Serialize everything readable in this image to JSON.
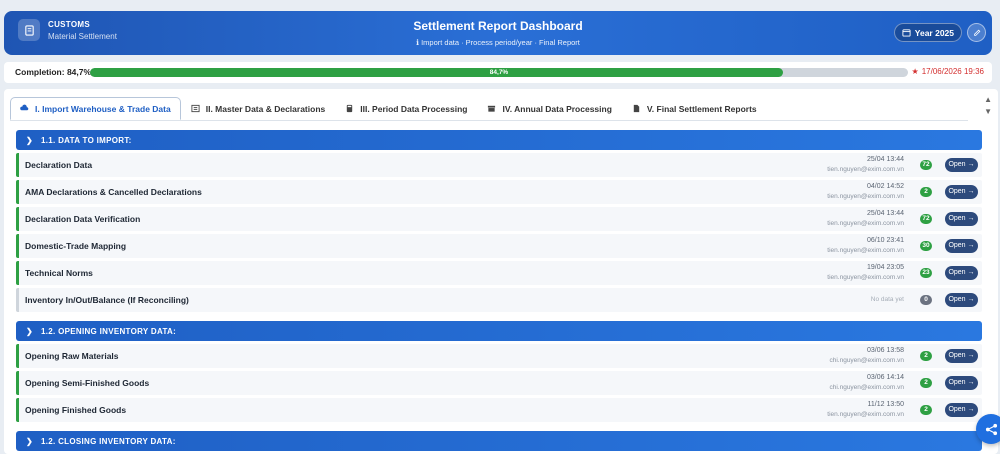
{
  "header": {
    "brand_line1": "CUSTOMS",
    "brand_line2": "Material Settlement",
    "title": "Settlement Report Dashboard",
    "subtitle": "Import data · Process period/year · Final Report",
    "year_label": "Year 2025"
  },
  "progress": {
    "label": "Completion: 84,7%",
    "percent": 84.7,
    "percent_text": "84,7%",
    "deadline": "17/06/2026 19:36"
  },
  "tabs": [
    {
      "label": "I. Import Warehouse & Trade Data",
      "active": true
    },
    {
      "label": "II. Master Data & Declarations",
      "active": false
    },
    {
      "label": "III. Period Data Processing",
      "active": false
    },
    {
      "label": "IV. Annual Data Processing",
      "active": false
    },
    {
      "label": "V. Final Settlement Reports",
      "active": false
    }
  ],
  "sections": [
    {
      "title": "1.1. DATA TO IMPORT:",
      "rows": [
        {
          "name": "Declaration Data",
          "date": "25/04 13:44",
          "user": "tien.nguyen@exim.com.vn",
          "count": "72",
          "open": "Open"
        },
        {
          "name": "AMA Declarations & Cancelled Declarations",
          "date": "04/02 14:52",
          "user": "tien.nguyen@exim.com.vn",
          "count": "2",
          "open": "Open"
        },
        {
          "name": "Declaration Data Verification",
          "date": "25/04 13:44",
          "user": "tien.nguyen@exim.com.vn",
          "count": "72",
          "open": "Open"
        },
        {
          "name": "Domestic-Trade Mapping",
          "date": "06/10 23:41",
          "user": "tien.nguyen@exim.com.vn",
          "count": "30",
          "open": "Open"
        },
        {
          "name": "Technical Norms",
          "date": "19/04 23:05",
          "user": "tien.nguyen@exim.com.vn",
          "count": "23",
          "open": "Open"
        },
        {
          "name": "Inventory In/Out/Balance (If Reconciling)",
          "date": "",
          "user": "",
          "nodata": "No data yet",
          "count": "0",
          "open": "Open"
        }
      ]
    },
    {
      "title": "1.2. OPENING INVENTORY DATA:",
      "rows": [
        {
          "name": "Opening Raw Materials",
          "date": "03/06 13:58",
          "user": "chi.nguyen@exim.com.vn",
          "count": "2",
          "open": "Open"
        },
        {
          "name": "Opening Semi-Finished Goods",
          "date": "03/06 14:14",
          "user": "chi.nguyen@exim.com.vn",
          "count": "2",
          "open": "Open"
        },
        {
          "name": "Opening Finished Goods",
          "date": "11/12 13:50",
          "user": "tien.nguyen@exim.com.vn",
          "count": "2",
          "open": "Open"
        }
      ]
    },
    {
      "title": "1.2. CLOSING INVENTORY DATA:",
      "rows": []
    }
  ]
}
